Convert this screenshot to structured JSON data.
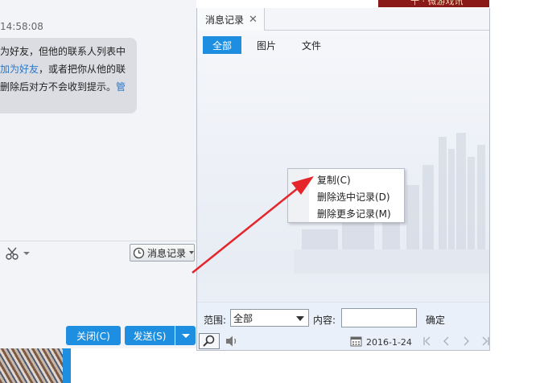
{
  "chat": {
    "timestamp": "14:58:08",
    "system_message": {
      "line1": "为好友，但他的联系人列表中",
      "line2_link": "加为好友",
      "line2_rest": "，或者把你从他的联",
      "line3": "删除后对方不会收到提示。",
      "line3_link": "管"
    },
    "toolbar": {
      "scissors_icon": "scissors-icon",
      "history_button": "消息记录"
    },
    "buttons": {
      "close": "关闭(C)",
      "send": "发送(S)"
    }
  },
  "history_panel": {
    "tab_title": "消息记录",
    "tab_close": "✕",
    "filters": [
      "全部",
      "图片",
      "文件"
    ],
    "active_filter": "全部",
    "search": {
      "range_label": "范围:",
      "range_value": "全部",
      "content_label": "内容:",
      "content_value": "",
      "confirm": "确定"
    },
    "footer": {
      "date": "2016-1-24"
    }
  },
  "context_menu": {
    "items": [
      "复制(C)",
      "删除选中记录(D)",
      "删除更多记录(M)"
    ]
  },
  "top_banner": {
    "text": "十 · 微游戏讯"
  },
  "colors": {
    "accent": "#1e8fe0",
    "arrow": "#e6252b",
    "bubble": "#dcdde3"
  }
}
